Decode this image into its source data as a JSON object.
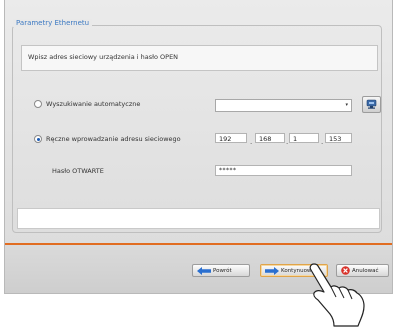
{
  "group": {
    "title": "Parametry Ethernetu"
  },
  "instruction": "Wpisz adres sieciowy urządzenia i hasło OPEN",
  "auto_search": {
    "label": "Wyszukiwanie automatyczne",
    "selected": false,
    "dropdown_value": "",
    "dropdown_arrow_icon": "chevron-down-icon",
    "refresh_icon": "network-refresh-icon"
  },
  "manual": {
    "label": "Ręczne wprowadzanie adresu sieciowego",
    "selected": true,
    "ip": [
      "192",
      "168",
      "1",
      "153"
    ],
    "separator": "."
  },
  "password": {
    "label": "Hasło OTWARTE",
    "value": "*****"
  },
  "status_text": "",
  "buttons": {
    "back": "Powrót",
    "next": "Kontynuować",
    "cancel": "Anulować"
  },
  "colors": {
    "accent": "#3c79c2",
    "separator": "#e16d22",
    "cancel_icon": "#d9322a",
    "arrow_icon": "#2a6fd0"
  }
}
